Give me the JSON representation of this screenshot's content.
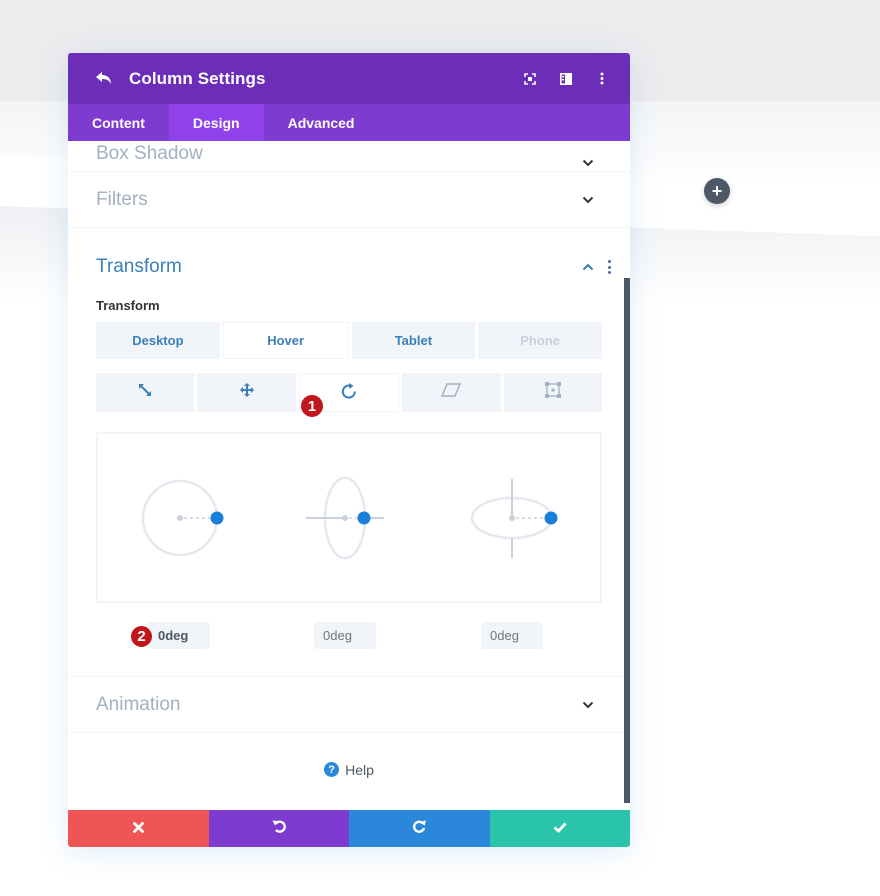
{
  "colors": {
    "header_bg": "#6c2eb9",
    "tabs_bg": "#7e3bd0",
    "tab_active_bg": "#8f42ec",
    "accent_blue": "#2b87da",
    "cancel": "#ef5555",
    "undo": "#7e3bd0",
    "redo": "#2b87da",
    "save": "#29c4a9",
    "badge_red": "#c0171c"
  },
  "canvas": {
    "add_section_icon": "plus-icon"
  },
  "modal": {
    "title": "Column Settings",
    "header_icons": [
      "back-icon",
      "fullscreen-icon",
      "split-view-icon",
      "more-options-icon"
    ],
    "tabs": [
      {
        "label": "Content",
        "active": false
      },
      {
        "label": "Design",
        "active": true
      },
      {
        "label": "Advanced",
        "active": false
      }
    ],
    "sections": {
      "box_shadow": {
        "title": "Box Shadow",
        "open": false
      },
      "filters": {
        "title": "Filters",
        "open": false
      },
      "transform": {
        "title": "Transform",
        "open": true,
        "field_label": "Transform",
        "device_tabs": [
          {
            "label": "Desktop",
            "state": "normal"
          },
          {
            "label": "Hover",
            "state": "active"
          },
          {
            "label": "Tablet",
            "state": "normal"
          },
          {
            "label": "Phone",
            "state": "disabled"
          }
        ],
        "tools": [
          {
            "name": "scale",
            "icon": "scale-icon",
            "active": false
          },
          {
            "name": "translate",
            "icon": "move-icon",
            "active": false
          },
          {
            "name": "rotate",
            "icon": "rotate-icon",
            "active": true
          },
          {
            "name": "skew",
            "icon": "skew-icon",
            "active": false
          },
          {
            "name": "origin",
            "icon": "origin-icon",
            "active": false
          }
        ],
        "rotate": {
          "x": {
            "value": "0deg",
            "placeholder": "0deg"
          },
          "y": {
            "value": "",
            "placeholder": "0deg"
          },
          "z": {
            "value": "",
            "placeholder": "0deg"
          }
        },
        "annotations": [
          "1",
          "2"
        ]
      },
      "animation": {
        "title": "Animation",
        "open": false
      }
    },
    "help_label": "Help",
    "footer": {
      "cancel_icon": "close-icon",
      "undo_icon": "undo-icon",
      "redo_icon": "redo-icon",
      "save_icon": "check-icon"
    }
  }
}
